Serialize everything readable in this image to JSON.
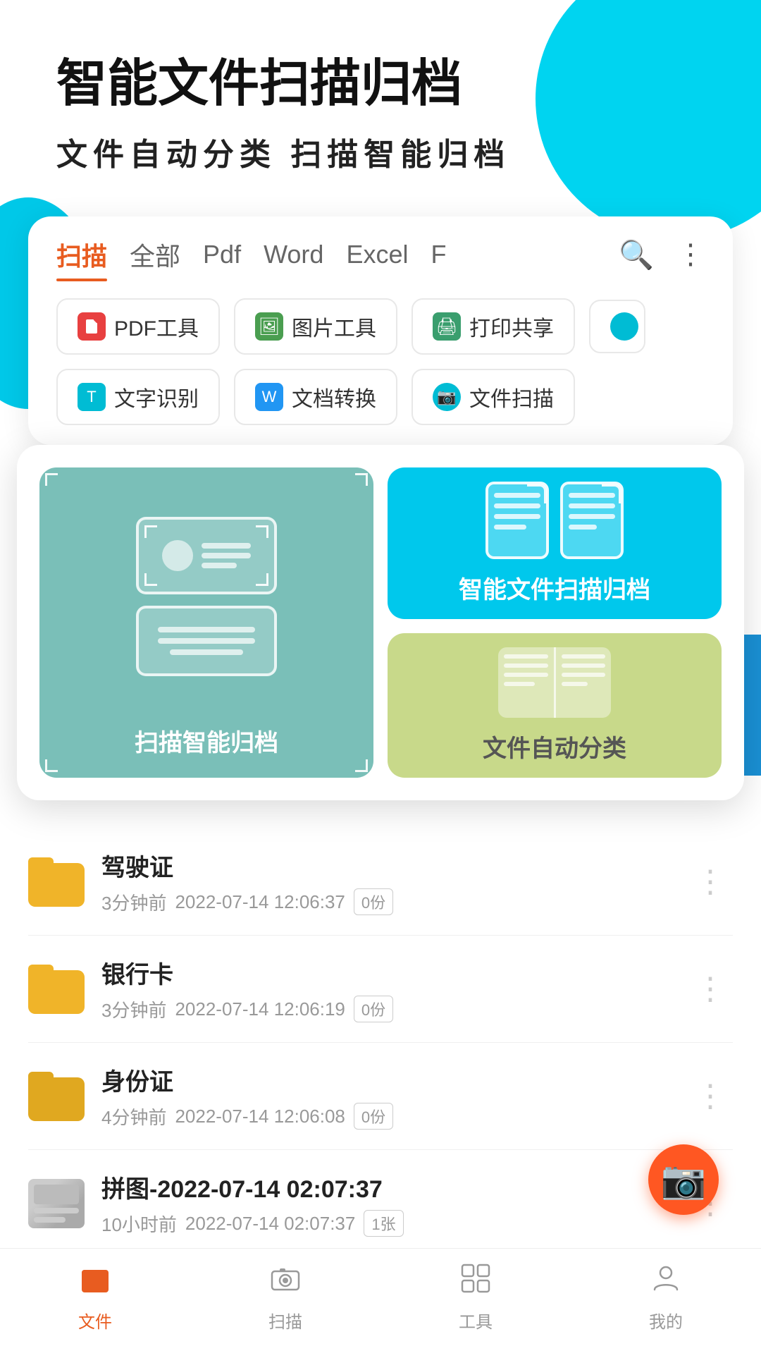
{
  "hero": {
    "title": "智能文件扫描归档",
    "subtitle": "文件自动分类   扫描智能归档"
  },
  "tabs": {
    "items": [
      {
        "label": "扫描",
        "active": true
      },
      {
        "label": "全部",
        "active": false
      },
      {
        "label": "Pdf",
        "active": false
      },
      {
        "label": "Word",
        "active": false
      },
      {
        "label": "Excel",
        "active": false
      },
      {
        "label": "F",
        "active": false
      }
    ]
  },
  "tools_row1": [
    {
      "icon": "pdf",
      "label": "PDF工具"
    },
    {
      "icon": "img",
      "label": "图片工具"
    },
    {
      "icon": "print",
      "label": "打印共享"
    }
  ],
  "tools_row2": [
    {
      "icon": "text",
      "label": "文字识别"
    },
    {
      "icon": "convert",
      "label": "文档转换"
    },
    {
      "icon": "scan",
      "label": "文件扫描"
    }
  ],
  "features": [
    {
      "id": "scan-archive",
      "label": "扫描智能归档",
      "color": "#7abfb8"
    },
    {
      "id": "file-scan",
      "label": "智能文件扫描归档",
      "color": "#00c8ec"
    },
    {
      "id": "auto-classify",
      "label": "文件自动分类",
      "color": "#c8d98a"
    }
  ],
  "files": [
    {
      "name": "驾驶证",
      "time": "3分钟前",
      "date": "2022-07-14 12:06:37",
      "badge": "0份",
      "type": "folder"
    },
    {
      "name": "银行卡",
      "time": "3分钟前",
      "date": "2022-07-14 12:06:19",
      "badge": "0份",
      "type": "folder"
    },
    {
      "name": "身份证",
      "time": "4分钟前",
      "date": "2022-07-14 12:06:08",
      "badge": "0份",
      "type": "folder"
    },
    {
      "name": "拼图-2022-07-14 02:07:37",
      "time": "10小时前",
      "date": "2022-07-14 02:07:37",
      "badge": "1张",
      "type": "image"
    }
  ],
  "nav": {
    "items": [
      {
        "label": "文件",
        "icon": "folder",
        "active": true
      },
      {
        "label": "扫描",
        "icon": "camera",
        "active": false
      },
      {
        "label": "工具",
        "icon": "tools",
        "active": false
      },
      {
        "label": "我的",
        "icon": "person",
        "active": false
      }
    ]
  }
}
